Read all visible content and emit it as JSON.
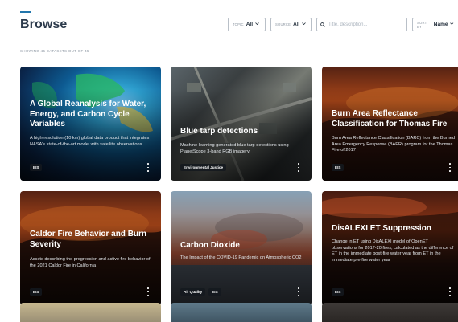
{
  "header": {
    "title": "Browse"
  },
  "filters": {
    "topic": {
      "label": "TOPIC",
      "value": "All"
    },
    "source": {
      "label": "SOURCE",
      "value": "All"
    },
    "search": {
      "placeholder": "Title, description..."
    },
    "sort": {
      "label": "SORT BY",
      "value": "Name"
    }
  },
  "results": {
    "count_text": "SHOWING 45 DATASETS OUT OF 45"
  },
  "cards": [
    {
      "title": "A Global Reanalysis for Water, Energy, and Carbon Cycle Variables",
      "description": "A high-resolution (10 km) global data product that integrates NASA's state-of-the-art model with satellite observations.",
      "tags": [
        "EIS"
      ]
    },
    {
      "title": "Blue tarp detections",
      "description": "Machine learning generated blue tarp detections using PlanetScope 3-band RGB imagery.",
      "tags": [
        "Environmental Justice"
      ]
    },
    {
      "title": "Burn Area Reflectance Classification for Thomas Fire",
      "description": "Burn Area Reflectance Classification (BARC) from the Burned Area Emergency Response (BAER) program for the Thomas Fire of 2017",
      "tags": [
        "EIS"
      ]
    },
    {
      "title": "Caldor Fire Behavior and Burn Severity",
      "description": "Assets describing the progression and active fire behavior of the 2021 Caldor Fire in California",
      "tags": [
        "EIS"
      ]
    },
    {
      "title": "Carbon Dioxide",
      "description": "The Impact of the COVID-19 Pandemic on Atmospheric CO2",
      "tags": [
        "Air Quality",
        "EIS"
      ]
    },
    {
      "title": "DisALEXI ET Suppression",
      "description": "Change in ET using DisALEXI model of OpenET observations for 2017-20 fires, calculated as the difference of ET in the immediate post-fire water year from ET in the immediate pre-fire water year",
      "tags": [
        "EIS"
      ]
    }
  ]
}
